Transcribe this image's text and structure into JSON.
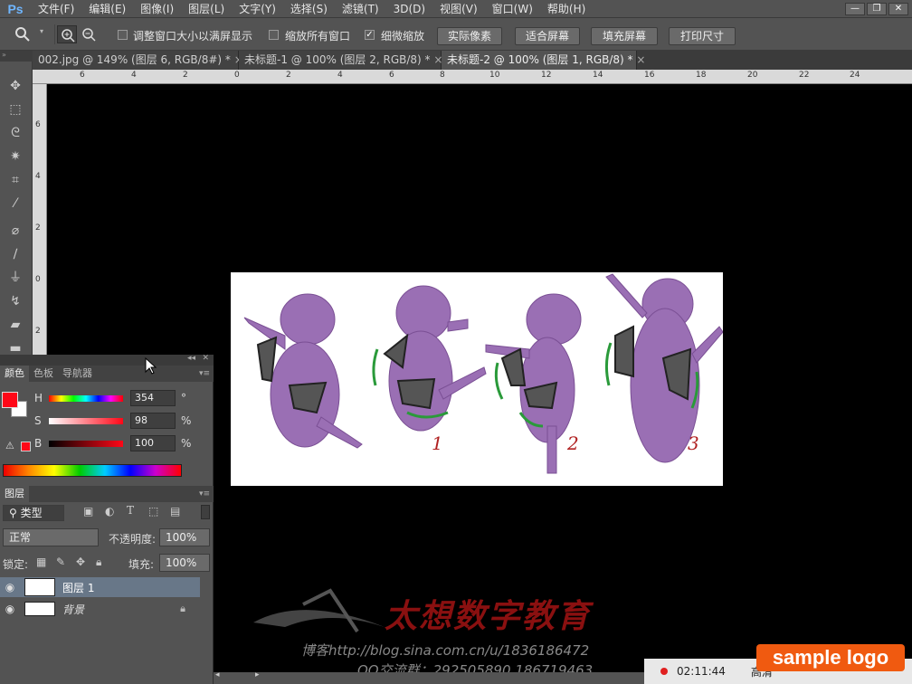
{
  "app": {
    "logo": "Ps"
  },
  "menu": [
    "文件(F)",
    "编辑(E)",
    "图像(I)",
    "图层(L)",
    "文字(Y)",
    "选择(S)",
    "滤镜(T)",
    "3D(D)",
    "视图(V)",
    "窗口(W)",
    "帮助(H)"
  ],
  "window_controls": {
    "minimize": "—",
    "restore": "❐",
    "close": "✕"
  },
  "options": {
    "check_resize_windows": "调整窗口大小以满屏显示",
    "check_zoom_all": "缩放所有窗口",
    "check_scrubby": "细微缩放",
    "btn_actual": "实际像素",
    "btn_fit": "适合屏幕",
    "btn_fill": "填充屏幕",
    "btn_print": "打印尺寸"
  },
  "tabs": [
    {
      "label": "002.jpg @ 149% (图层 6, RGB/8#) *",
      "close": "×"
    },
    {
      "label": "未标题-1 @ 100% (图层 2, RGB/8) *",
      "close": "×"
    },
    {
      "label": "未标题-2 @ 100% (图层 1, RGB/8) *",
      "close": "×"
    }
  ],
  "ruler_h": [
    "6",
    "4",
    "2",
    "0",
    "2",
    "4",
    "6",
    "8",
    "10",
    "12",
    "14",
    "16",
    "18",
    "20",
    "22",
    "24"
  ],
  "ruler_v": [
    "6",
    "4",
    "2",
    "0",
    "2"
  ],
  "color_panel": {
    "tabs": [
      "颜色",
      "色板",
      "导航器"
    ],
    "h_label": "H",
    "h_value": "354",
    "h_unit": "°",
    "s_label": "S",
    "s_value": "98",
    "s_unit": "%",
    "b_label": "B",
    "b_value": "100",
    "b_unit": "%",
    "fg_color": "#ff0717"
  },
  "layers_panel": {
    "title": "图层",
    "filter_label": "类型",
    "blend_mode": "正常",
    "opacity_label": "不透明度:",
    "opacity_value": "100%",
    "lock_label": "锁定:",
    "fill_label": "填充:",
    "fill_value": "100%",
    "layers": [
      {
        "name": "图层 1",
        "selected": true
      },
      {
        "name": "背景",
        "locked": true
      }
    ]
  },
  "canvas": {
    "numbers": [
      "1",
      "2",
      "3"
    ]
  },
  "watermark": {
    "title": "太想数字教育",
    "blog": "博客http://blog.sina.com.cn/u/1836186472",
    "qq": "QQ交流群：292505890  186719463"
  },
  "recorder": {
    "time": "02:11:44",
    "quality": "高清",
    "sample_logo": "sample logo"
  }
}
